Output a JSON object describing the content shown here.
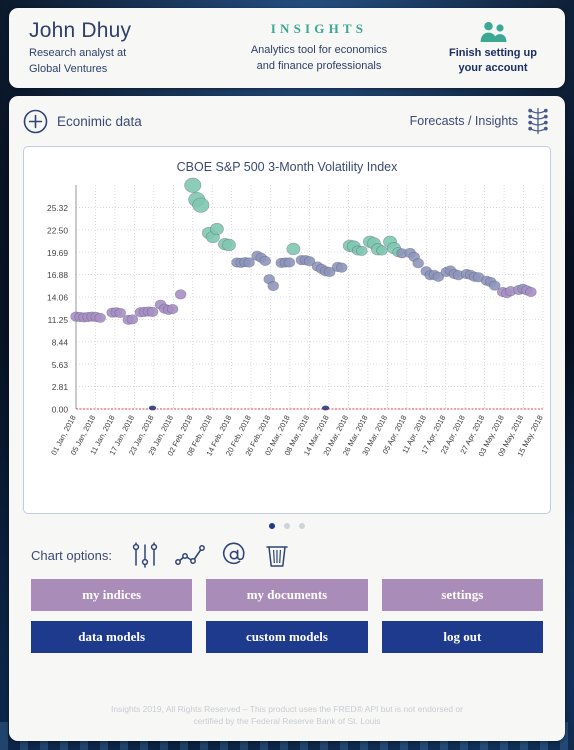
{
  "header": {
    "user_name": "John Dhuy",
    "user_role_line1": "Research analyst at",
    "user_role_line2": "Global Ventures",
    "brand": "INSIGHTS",
    "tagline_line1": "Analytics tool for economics",
    "tagline_line2": "and finance professionals",
    "finish_line1": "Finish setting up",
    "finish_line2": "your account",
    "users_icon": "users-icon",
    "brand_color": "#3aa893",
    "text_color": "#2e3f6b"
  },
  "toolbar": {
    "add_icon": "plus-circle-icon",
    "econimic_data_label": "Econimic data",
    "forecasts_label": "Forecasts / Insights",
    "tree_icon": "decision-tree-icon"
  },
  "chart_options": {
    "label": "Chart options:",
    "icons": [
      "sliders-icon",
      "line-chart-icon",
      "at-sign-icon",
      "trash-icon"
    ]
  },
  "pager": {
    "count": 3,
    "active": 0
  },
  "buttons": {
    "row1": [
      "my indices",
      "my documents",
      "settings"
    ],
    "row2": [
      "data models",
      "custom models",
      "log out"
    ],
    "purple": "#aa8cb9",
    "navy": "#1e3a8c"
  },
  "footer": {
    "line1": "Insights 2019, All Rights Reserved – This product uses the FRED® API but is not endorsed or",
    "line2": "certified by the Federal Reserve Bank of St. Louis"
  },
  "chart_data": {
    "type": "scatter",
    "title": "CBOE S&P 500 3-Month Volatility Index",
    "xlabel": "",
    "ylabel": "",
    "grid": true,
    "legend": false,
    "ylim": [
      0.0,
      28.13
    ],
    "yticks": [
      0.0,
      2.81,
      5.63,
      8.44,
      11.25,
      14.06,
      16.88,
      19.69,
      22.5,
      25.32
    ],
    "ytick_labels": [
      "0.00",
      "2.81",
      "5.63",
      "8.44",
      "11.25",
      "14.06",
      "16.88",
      "19.69",
      "22.50",
      "25.32"
    ],
    "xtick_labels": [
      "01 Jan, 2018",
      "05 Jan, 2018",
      "11 Jan, 2018",
      "17 Jan, 2018",
      "23 Jan, 2018",
      "29 Jan, 2018",
      "02 Feb, 2018",
      "08 Feb, 2018",
      "14 Feb, 2018",
      "20 Feb, 2018",
      "26 Feb, 2018",
      "02 Mar, 2018",
      "08 Mar, 2018",
      "14 Mar, 2018",
      "20 Mar, 2018",
      "26 Mar, 2018",
      "30 Mar, 2018",
      "05 Apr, 2018",
      "11 Apr, 2018",
      "17 Apr, 2018",
      "23 Apr, 2018",
      "27 Apr, 2018",
      "03 May, 2018",
      "09 May, 2018",
      "15 May, 2018"
    ],
    "zero_line_color": "#d94a4a",
    "point_colors": {
      "low": "#a890c4",
      "mid": "#8e96bc",
      "high": "#7fc8b0"
    },
    "points": [
      {
        "x": 0,
        "y": 11.6
      },
      {
        "x": 1,
        "y": 11.55
      },
      {
        "x": 2,
        "y": 11.5
      },
      {
        "x": 3,
        "y": 11.55
      },
      {
        "x": 4,
        "y": 11.6
      },
      {
        "x": 5,
        "y": 11.55
      },
      {
        "x": 6,
        "y": 11.45
      },
      {
        "x": 9,
        "y": 12.1
      },
      {
        "x": 10,
        "y": 12.15
      },
      {
        "x": 11,
        "y": 12.05
      },
      {
        "x": 13,
        "y": 11.2
      },
      {
        "x": 14,
        "y": 11.25
      },
      {
        "x": 16,
        "y": 12.15
      },
      {
        "x": 17,
        "y": 12.2
      },
      {
        "x": 18,
        "y": 12.25
      },
      {
        "x": 19,
        "y": 12.2
      },
      {
        "x": 21,
        "y": 13.1
      },
      {
        "x": 22,
        "y": 12.6
      },
      {
        "x": 23,
        "y": 12.45
      },
      {
        "x": 24,
        "y": 12.55
      },
      {
        "x": 26,
        "y": 14.4
      },
      {
        "x": 29,
        "y": 28.1
      },
      {
        "x": 30,
        "y": 26.3
      },
      {
        "x": 31,
        "y": 25.6
      },
      {
        "x": 33,
        "y": 22.1
      },
      {
        "x": 34,
        "y": 21.6
      },
      {
        "x": 35,
        "y": 22.6
      },
      {
        "x": 37,
        "y": 20.7
      },
      {
        "x": 38,
        "y": 20.6
      },
      {
        "x": 40,
        "y": 18.4
      },
      {
        "x": 41,
        "y": 18.35
      },
      {
        "x": 42,
        "y": 18.45
      },
      {
        "x": 43,
        "y": 18.4
      },
      {
        "x": 45,
        "y": 19.25
      },
      {
        "x": 46,
        "y": 19.0
      },
      {
        "x": 47,
        "y": 18.6
      },
      {
        "x": 48,
        "y": 16.3
      },
      {
        "x": 49,
        "y": 15.45
      },
      {
        "x": 51,
        "y": 18.35
      },
      {
        "x": 52,
        "y": 18.4
      },
      {
        "x": 53,
        "y": 18.4
      },
      {
        "x": 54,
        "y": 20.1
      },
      {
        "x": 56,
        "y": 18.7
      },
      {
        "x": 57,
        "y": 18.7
      },
      {
        "x": 58,
        "y": 18.55
      },
      {
        "x": 60,
        "y": 17.9
      },
      {
        "x": 61,
        "y": 17.6
      },
      {
        "x": 62,
        "y": 17.3
      },
      {
        "x": 63,
        "y": 17.2
      },
      {
        "x": 65,
        "y": 17.85
      },
      {
        "x": 66,
        "y": 17.75
      },
      {
        "x": 68,
        "y": 20.5
      },
      {
        "x": 69,
        "y": 20.4
      },
      {
        "x": 70,
        "y": 19.9
      },
      {
        "x": 71,
        "y": 19.85
      },
      {
        "x": 73,
        "y": 21.0
      },
      {
        "x": 74,
        "y": 20.8
      },
      {
        "x": 75,
        "y": 20.05
      },
      {
        "x": 76,
        "y": 19.9
      },
      {
        "x": 78,
        "y": 21.0
      },
      {
        "x": 79,
        "y": 20.2
      },
      {
        "x": 80,
        "y": 19.7
      },
      {
        "x": 81,
        "y": 19.55
      },
      {
        "x": 83,
        "y": 19.6
      },
      {
        "x": 84,
        "y": 19.1
      },
      {
        "x": 85,
        "y": 18.3
      },
      {
        "x": 87,
        "y": 17.3
      },
      {
        "x": 88,
        "y": 16.8
      },
      {
        "x": 89,
        "y": 16.85
      },
      {
        "x": 90,
        "y": 16.6
      },
      {
        "x": 92,
        "y": 17.2
      },
      {
        "x": 93,
        "y": 17.4
      },
      {
        "x": 94,
        "y": 16.95
      },
      {
        "x": 95,
        "y": 16.8
      },
      {
        "x": 97,
        "y": 16.95
      },
      {
        "x": 98,
        "y": 16.85
      },
      {
        "x": 99,
        "y": 16.6
      },
      {
        "x": 100,
        "y": 16.55
      },
      {
        "x": 102,
        "y": 16.1
      },
      {
        "x": 103,
        "y": 15.95
      },
      {
        "x": 104,
        "y": 15.5
      },
      {
        "x": 106,
        "y": 14.7
      },
      {
        "x": 107,
        "y": 14.55
      },
      {
        "x": 108,
        "y": 14.8
      },
      {
        "x": 110,
        "y": 14.95
      },
      {
        "x": 111,
        "y": 15.1
      },
      {
        "x": 112,
        "y": 14.9
      },
      {
        "x": 113,
        "y": 14.7
      }
    ],
    "zero_points": [
      {
        "x": 19,
        "y": 0.0
      },
      {
        "x": 62,
        "y": 0.0
      }
    ]
  }
}
